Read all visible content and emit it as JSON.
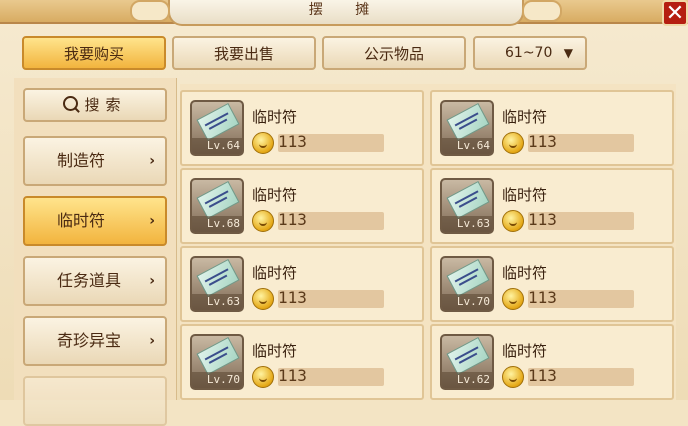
{
  "title": "摆 摊",
  "tabs": [
    {
      "label": "我要购买",
      "active": true
    },
    {
      "label": "我要出售",
      "active": false
    },
    {
      "label": "公示物品",
      "active": false
    }
  ],
  "level_range": {
    "label": "61~70",
    "icon": "dropdown-arrow-icon"
  },
  "sidebar": {
    "search_label": "搜索",
    "categories": [
      {
        "label": "制造符",
        "active": false
      },
      {
        "label": "临时符",
        "active": true
      },
      {
        "label": "任务道具",
        "active": false
      },
      {
        "label": "奇珍异宝",
        "active": false
      },
      {
        "label": "",
        "active": false
      }
    ]
  },
  "items": [
    {
      "name": "临时符",
      "level": "Lv.64",
      "price": "113"
    },
    {
      "name": "临时符",
      "level": "Lv.64",
      "price": "113"
    },
    {
      "name": "临时符",
      "level": "Lv.68",
      "price": "113"
    },
    {
      "name": "临时符",
      "level": "Lv.63",
      "price": "113"
    },
    {
      "name": "临时符",
      "level": "Lv.63",
      "price": "113"
    },
    {
      "name": "临时符",
      "level": "Lv.70",
      "price": "113"
    },
    {
      "name": "临时符",
      "level": "Lv.70",
      "price": "113"
    },
    {
      "name": "临时符",
      "level": "Lv.62",
      "price": "113"
    }
  ],
  "colors": {
    "accent": "#f2b43e",
    "close": "#b51e10",
    "panel": "#f9ecd0"
  }
}
